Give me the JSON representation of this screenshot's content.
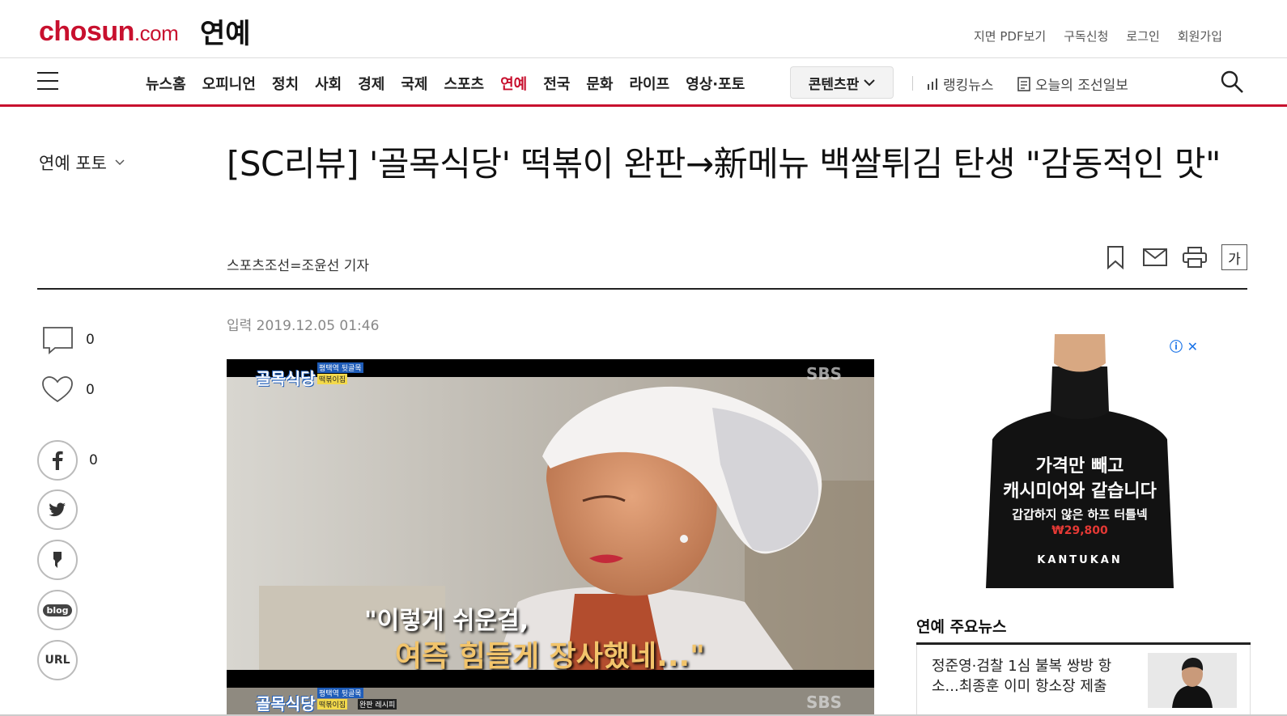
{
  "header": {
    "logo_main": "chosun",
    "logo_suffix": ".com",
    "section": "연예",
    "util_links": [
      "지면 PDF보기",
      "구독신청",
      "로그인",
      "회원가입"
    ]
  },
  "nav": {
    "items": [
      "뉴스홈",
      "오피니언",
      "정치",
      "사회",
      "경제",
      "국제",
      "스포츠",
      "연예",
      "전국",
      "문화",
      "라이프",
      "영상·포토"
    ],
    "active_index": 7,
    "content_button": "콘텐츠판",
    "ranking": "랭킹뉴스",
    "todays_paper": "오늘의 조선일보"
  },
  "article": {
    "side_section": "연예 포토",
    "headline": "[SC리뷰] '골목식당' 떡볶이 완판→新메뉴 백쌀튀김 탄생 \"감동적인 맛\"",
    "byline": "스포츠조선=조윤선 기자",
    "input_date": "입력 2019.12.05 01:46",
    "font_tool_label": "가",
    "photo": {
      "badge_top": "골목식당",
      "badge_sub1": "평택역 뒷골목",
      "badge_sub2": "떡볶이집",
      "broadcaster": "SBS",
      "caption_line1": "\"이렇게 쉬운걸,",
      "caption_line2": "여즉 힘들게 장사했네...\"",
      "badge_sub3": "완판 레시피"
    }
  },
  "share": {
    "comment_count": "0",
    "like_count": "0",
    "facebook_count": "0",
    "blog_label": "blog",
    "url_label": "URL"
  },
  "ad": {
    "headline1": "가격만 빼고",
    "headline2": "캐시미어와 같습니다",
    "sub": "갑갑하지 않은 하프 터틀넥",
    "price": "₩29,800",
    "brand": "KANTUKAN"
  },
  "major_news": {
    "title": "연예 주요뉴스",
    "item_text": "정준영·검찰 1심 불복 쌍방 항소...최종훈 이미 항소장 제출"
  },
  "colors": {
    "brand_red": "#c8102e",
    "text_dark": "#222222"
  }
}
